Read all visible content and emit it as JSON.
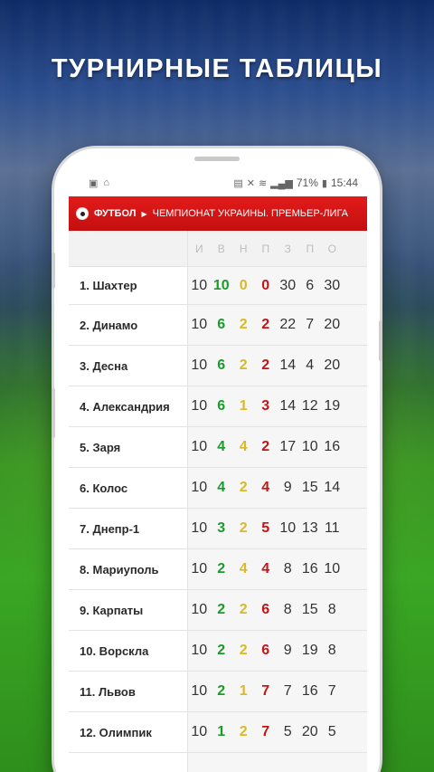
{
  "headline": "ТУРНИРНЫЕ ТАБЛИЦЫ",
  "status_bar": {
    "battery": "71%",
    "time": "15:44"
  },
  "breadcrumb": {
    "sport": "ФУТБОЛ",
    "league": "ЧЕМПИОНАТ УКРАИНЫ. ПРЕМЬЕР-ЛИГА"
  },
  "table": {
    "columns": [
      "И",
      "В",
      "Н",
      "П",
      "З",
      "П",
      "О"
    ],
    "rows": [
      {
        "team": "1. Шахтер",
        "games": "10",
        "wins": "10",
        "draws": "0",
        "losses": "0",
        "scored": "30",
        "conceded": "6",
        "points": "30"
      },
      {
        "team": "2. Динамо",
        "games": "10",
        "wins": "6",
        "draws": "2",
        "losses": "2",
        "scored": "22",
        "conceded": "7",
        "points": "20"
      },
      {
        "team": "3. Десна",
        "games": "10",
        "wins": "6",
        "draws": "2",
        "losses": "2",
        "scored": "14",
        "conceded": "4",
        "points": "20"
      },
      {
        "team": "4. Александрия",
        "games": "10",
        "wins": "6",
        "draws": "1",
        "losses": "3",
        "scored": "14",
        "conceded": "12",
        "points": "19"
      },
      {
        "team": "5. Заря",
        "games": "10",
        "wins": "4",
        "draws": "4",
        "losses": "2",
        "scored": "17",
        "conceded": "10",
        "points": "16"
      },
      {
        "team": "6. Колос",
        "games": "10",
        "wins": "4",
        "draws": "2",
        "losses": "4",
        "scored": "9",
        "conceded": "15",
        "points": "14"
      },
      {
        "team": "7. Днепр-1",
        "games": "10",
        "wins": "3",
        "draws": "2",
        "losses": "5",
        "scored": "10",
        "conceded": "13",
        "points": "11"
      },
      {
        "team": "8. Мариуполь",
        "games": "10",
        "wins": "2",
        "draws": "4",
        "losses": "4",
        "scored": "8",
        "conceded": "16",
        "points": "10"
      },
      {
        "team": "9. Карпаты",
        "games": "10",
        "wins": "2",
        "draws": "2",
        "losses": "6",
        "scored": "8",
        "conceded": "15",
        "points": "8"
      },
      {
        "team": "10. Ворскла",
        "games": "10",
        "wins": "2",
        "draws": "2",
        "losses": "6",
        "scored": "9",
        "conceded": "19",
        "points": "8"
      },
      {
        "team": "11. Львов",
        "games": "10",
        "wins": "2",
        "draws": "1",
        "losses": "7",
        "scored": "7",
        "conceded": "16",
        "points": "7"
      },
      {
        "team": "12. Олимпик",
        "games": "10",
        "wins": "1",
        "draws": "2",
        "losses": "7",
        "scored": "5",
        "conceded": "20",
        "points": "5"
      }
    ]
  },
  "colors": {
    "header_red": "#d31414",
    "wins": "#1a9c2a",
    "draws": "#d9b82a",
    "losses": "#c41414"
  }
}
